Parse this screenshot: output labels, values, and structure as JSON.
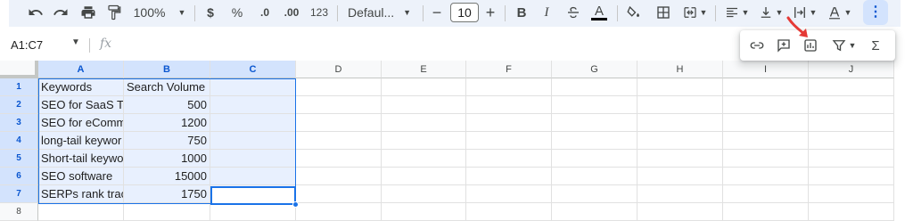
{
  "toolbar": {
    "zoom": "100%",
    "currency": "$",
    "percent": "%",
    "decrease_decimals": ".0",
    "increase_decimals": ".00",
    "more_formats": "123",
    "font_family": "Defaul...",
    "font_size": "10",
    "bold": "B",
    "italic": "I",
    "text_color": "A"
  },
  "formula_bar": {
    "name_box": "A1:C7",
    "fx": "fx"
  },
  "popup": {
    "sum": "Σ"
  },
  "columns": [
    "A",
    "B",
    "C",
    "D",
    "E",
    "F",
    "G",
    "H",
    "I",
    "J"
  ],
  "rows": [
    {
      "n": "1",
      "a": "Keywords",
      "b": "Search Volume"
    },
    {
      "n": "2",
      "a": "SEO for SaaS Te",
      "b": "500"
    },
    {
      "n": "3",
      "a": "SEO for eComm",
      "b": "1200"
    },
    {
      "n": "4",
      "a": "long-tail keywor",
      "b": "750"
    },
    {
      "n": "5",
      "a": "Short-tail keywor",
      "b": "1000"
    },
    {
      "n": "6",
      "a": "SEO software",
      "b": "15000"
    },
    {
      "n": "7",
      "a": "SERPs rank trac",
      "b": "1750"
    },
    {
      "n": "8",
      "a": "",
      "b": ""
    }
  ],
  "colors": {
    "accent": "#1a73e8",
    "selection": "#e8f0fe",
    "header_selected": "#d3e3fd",
    "annotation_arrow": "#e53935"
  }
}
